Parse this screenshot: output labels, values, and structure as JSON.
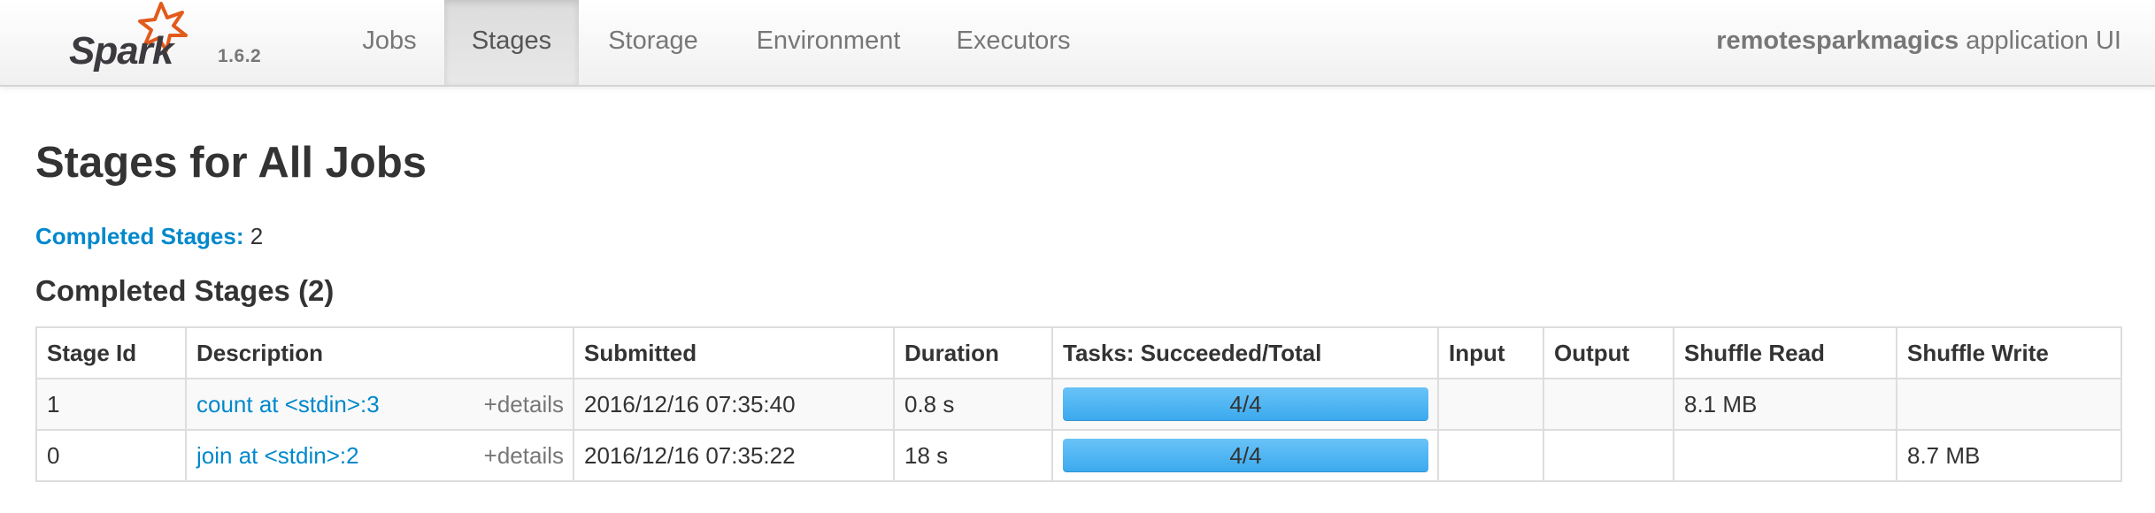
{
  "brand": {
    "logo_text": "Spark",
    "version": "1.6.2",
    "logo_color": "#e25a1c"
  },
  "nav": {
    "tabs": [
      {
        "label": "Jobs",
        "active": false
      },
      {
        "label": "Stages",
        "active": true
      },
      {
        "label": "Storage",
        "active": false
      },
      {
        "label": "Environment",
        "active": false
      },
      {
        "label": "Executors",
        "active": false
      }
    ],
    "app_name": "remotesparkmagics",
    "app_suffix": " application UI"
  },
  "page": {
    "title": "Stages for All Jobs",
    "completed_label": "Completed Stages:",
    "completed_count": "2",
    "section_title": "Completed Stages (2)"
  },
  "table": {
    "headers": [
      "Stage Id",
      "Description",
      "Submitted",
      "Duration",
      "Tasks: Succeeded/Total",
      "Input",
      "Output",
      "Shuffle Read",
      "Shuffle Write"
    ],
    "rows": [
      {
        "stage_id": "1",
        "description": "count at <stdin>:3",
        "details": "+details",
        "submitted": "2016/12/16 07:35:40",
        "duration": "0.8 s",
        "tasks_label": "4/4",
        "tasks_progress": 1.0,
        "input": "",
        "output": "",
        "shuffle_read": "8.1 MB",
        "shuffle_write": ""
      },
      {
        "stage_id": "0",
        "description": "join at <stdin>:2",
        "details": "+details",
        "submitted": "2016/12/16 07:35:22",
        "duration": "18 s",
        "tasks_label": "4/4",
        "tasks_progress": 1.0,
        "input": "",
        "output": "",
        "shuffle_read": "",
        "shuffle_write": "8.7 MB"
      }
    ]
  },
  "colors": {
    "link": "#0088cc",
    "progress": "#4fb6f3"
  }
}
